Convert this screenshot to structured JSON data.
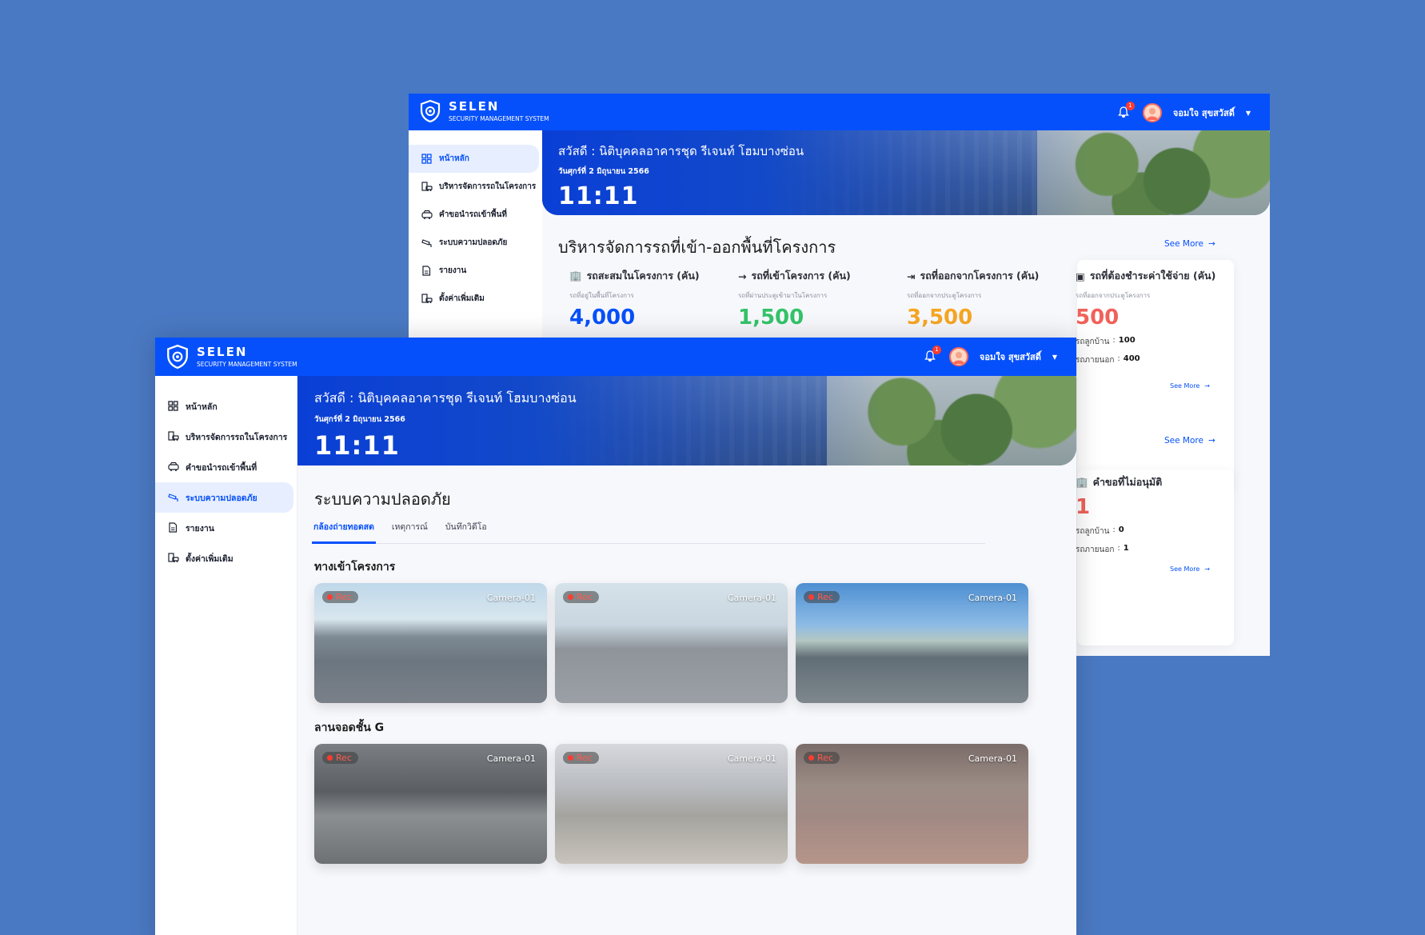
{
  "brand": {
    "name": "SELEN",
    "subtitle": "SECURITY MANAGEMENT SYSTEM"
  },
  "header": {
    "notification_count": "1",
    "user_name": "จอมใจ สุขสวัสดิ์"
  },
  "sidebar": {
    "items": [
      {
        "label": "หน้าหลัก",
        "icon": "grid-icon"
      },
      {
        "label": "บริหารจัดการรถในโครงการ",
        "icon": "car-building-icon"
      },
      {
        "label": "คำขอนำรถเข้าพื้นที่",
        "icon": "car-request-icon"
      },
      {
        "label": "ระบบความปลอดภัย",
        "icon": "cctv-icon"
      },
      {
        "label": "รายงาน",
        "icon": "document-icon"
      },
      {
        "label": "ตั้งค่าเพิ่มเติม",
        "icon": "settings-icon"
      }
    ]
  },
  "banner": {
    "greeting": "สวัสดี : นิติบุคคลอาคารชุด รีเจนท์ โฮมบางซ่อน",
    "date": "วันศุกร์ที่ 2 มิถุนายน 2566",
    "time": "11:11"
  },
  "dashboard": {
    "section_title": "บริหารจัดการรถที่เข้า-ออกพื้นที่โครงการ",
    "see_more": "See More",
    "stats": [
      {
        "title": "รถสะสมในโครงการ (คัน)",
        "sub": "รถที่อยู่ในพื้นที่โครงการ",
        "value": "4,000",
        "color": "#0650fb"
      },
      {
        "title": "รถที่เข้าโครงการ (คัน)",
        "sub": "รถที่ผ่านประตูเข้ามาในโครงการ",
        "value": "1,500",
        "color": "#34c369"
      },
      {
        "title": "รถที่ออกจากโครงการ (คัน)",
        "sub": "รถที่ออกจากประตูโครงการ",
        "value": "3,500",
        "color": "#f5a623"
      },
      {
        "title": "รถที่ต้องชำระค่าใช้จ่าย (คัน)",
        "sub": "รถที่ออกจากประตูโครงการ",
        "value": "500",
        "color": "#f0615a"
      }
    ],
    "payment_breakdown": {
      "resident_label": "รถลูกบ้าน",
      "resident_value": "100",
      "visitor_label": "รถภายนอก",
      "visitor_value": "400"
    },
    "rejected": {
      "title": "คำขอที่ไม่อนุมัติ",
      "value": "1",
      "resident_label": "รถลูกบ้าน",
      "resident_value": "0",
      "visitor_label": "รถภายนอก",
      "visitor_value": "1"
    }
  },
  "security": {
    "page_title": "ระบบความปลอดภัย",
    "tabs": [
      "กล้องถ่ายทอดสด",
      "เหตุการณ์",
      "บันทึกวิดีโอ"
    ],
    "groups": [
      {
        "title": "ทางเข้าโครงการ",
        "cameras": [
          {
            "rec": "Rec",
            "label": "Camera-01"
          },
          {
            "rec": "Rec",
            "label": "Camera-01"
          },
          {
            "rec": "Rec",
            "label": "Camera-01"
          }
        ]
      },
      {
        "title": "ลานจอดชั้น G",
        "cameras": [
          {
            "rec": "Rec",
            "label": "Camera-01"
          },
          {
            "rec": "Rec",
            "label": "Camera-01"
          },
          {
            "rec": "Rec",
            "label": "Camera-01"
          }
        ]
      }
    ]
  },
  "colors": {
    "primary": "#0650fb",
    "background": "#4a79c3",
    "green": "#34c369",
    "orange": "#f5a623",
    "red": "#f0615a"
  }
}
